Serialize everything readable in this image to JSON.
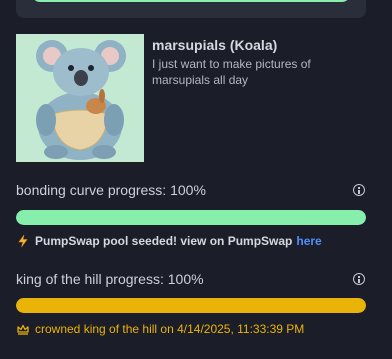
{
  "token": {
    "name": "marsupials (Koala)",
    "description": "I just want to make pictures of marsupials all day",
    "image": "koala-with-joey-illustration"
  },
  "bonding_curve": {
    "label": "bonding curve progress: 100%",
    "progress": 1.0,
    "color": "#86efac",
    "notice_text": "PumpSwap pool seeded! view on PumpSwap",
    "notice_link": "here",
    "notice_icon": "lightning-icon"
  },
  "king_of_hill": {
    "label": "king of the hill progress: 100%",
    "progress": 1.0,
    "color": "#eab308",
    "notice_text": "crowned king of the hill on 4/14/2025, 11:33:39 PM",
    "notice_icon": "crown-icon"
  },
  "colors": {
    "background": "#1b1d28",
    "track": "#2a2d3a",
    "link": "#4f8ff7"
  }
}
